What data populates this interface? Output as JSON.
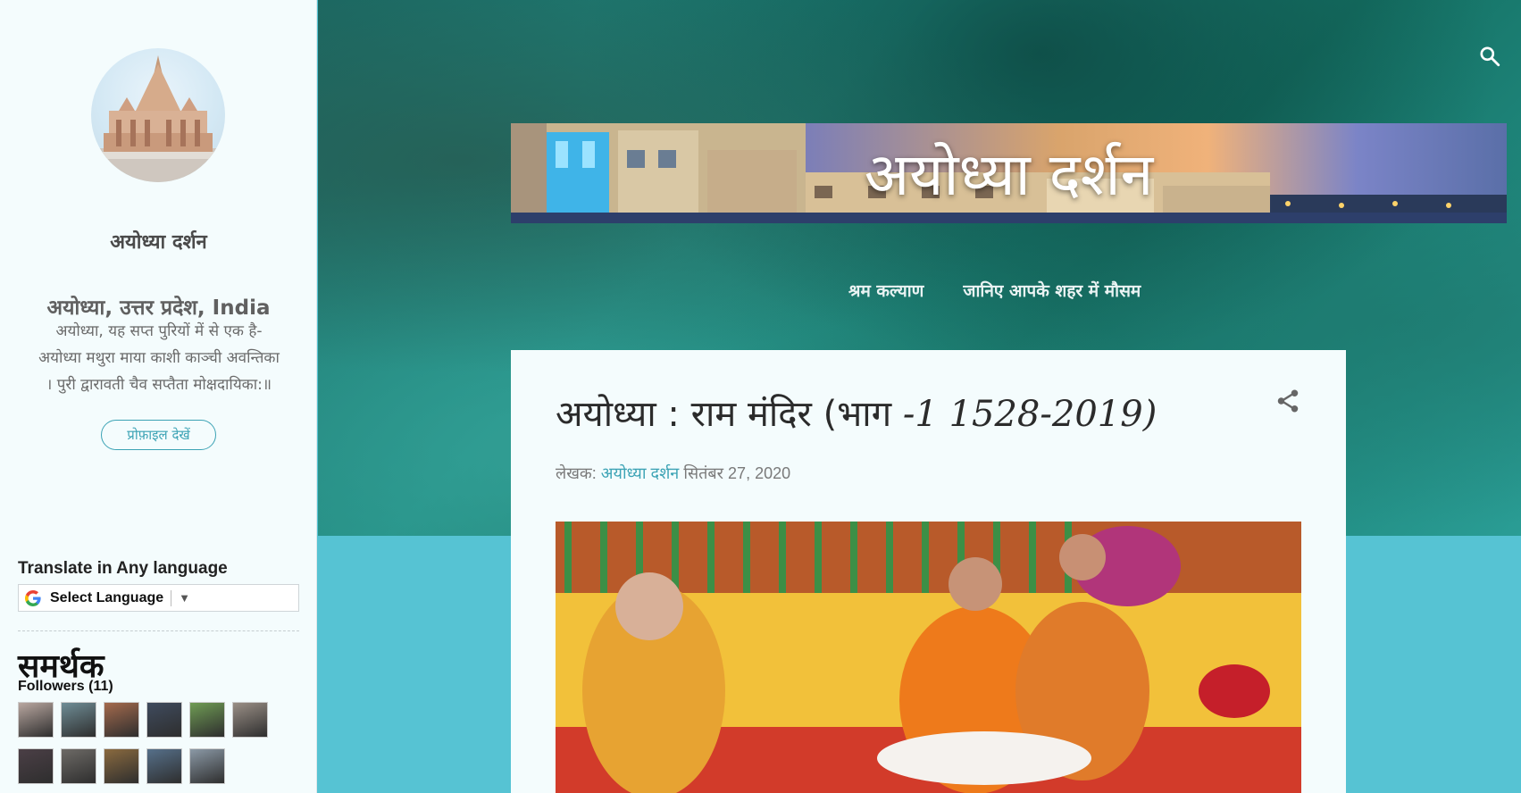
{
  "sidebar": {
    "blog_name": "अयोध्या दर्शन",
    "location": "अयोध्या, उत्तर प्रदेश, India",
    "about_lines": [
      "अयोध्या, यह सप्त पुरियों में से एक है-",
      "अयोध्या मथुरा माया काशी काञ्ची अवन्तिका",
      "। पुरी द्वारावती चैव सप्तैता मोक्षदायिका:॥"
    ],
    "profile_button": "प्रोफ़ाइल देखें",
    "translate_title": "Translate in Any language",
    "select_language": "Select Language",
    "select_arrow": "▼",
    "followers_title": "समर्थक",
    "followers_count": "Followers (11)",
    "follower_colors": [
      "#b9a7a0",
      "#6f8d96",
      "#a46a4d",
      "#3f4b5e",
      "#6f9c54",
      "#9a8f86",
      "#4b3f46",
      "#6d6a66",
      "#8a6a3f",
      "#56708a",
      "#8b99a6"
    ]
  },
  "header": {
    "banner_title": "अयोध्या दर्शन",
    "search_icon": "search-icon",
    "nav": [
      "श्रम कल्याण",
      "जानिए आपके शहर में मौसम"
    ]
  },
  "post": {
    "title_main": "अयोध्या : राम मंदिर (भाग ",
    "title_years": "-1 1528-2019)",
    "byline_prefix": "लेखक:",
    "author": "अयोध्या दर्शन",
    "date": "सितंबर 27, 2020",
    "share_icon": "share-icon"
  }
}
